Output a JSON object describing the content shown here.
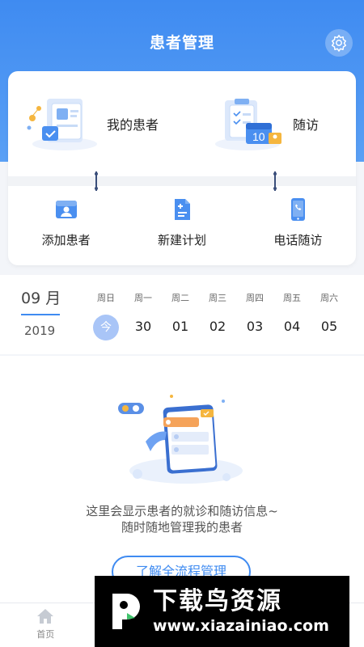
{
  "header": {
    "title": "患者管理",
    "settings_icon": "gear-icon",
    "color": "#3f8bf1"
  },
  "cards": {
    "my_patients": "我的患者",
    "follow_up": "随访",
    "calendar_badge": "10"
  },
  "actions": [
    {
      "label": "添加患者",
      "icon": "add-patient-icon"
    },
    {
      "label": "新建计划",
      "icon": "new-plan-icon"
    },
    {
      "label": "电话随访",
      "icon": "phone-icon"
    }
  ],
  "calendar": {
    "month": "09 月",
    "year": "2019",
    "weekdays": [
      "周日",
      "周一",
      "周二",
      "周三",
      "周四",
      "周五",
      "周六"
    ],
    "days": [
      "今",
      "30",
      "01",
      "02",
      "03",
      "04",
      "05"
    ]
  },
  "empty_state": {
    "line1": "这里会显示患者的就诊和随访信息~",
    "line2": "随时随地管理我的患者",
    "button": "了解全流程管理"
  },
  "tabbar": [
    {
      "label": "首页",
      "icon": "home-icon"
    },
    {
      "label": "",
      "icon": "patients-icon"
    },
    {
      "label": "",
      "icon": "tab-icon"
    },
    {
      "label": "",
      "icon": "profile-icon"
    }
  ],
  "watermark": {
    "title": "下载鸟资源",
    "url": "www.xiazainiao.com"
  }
}
